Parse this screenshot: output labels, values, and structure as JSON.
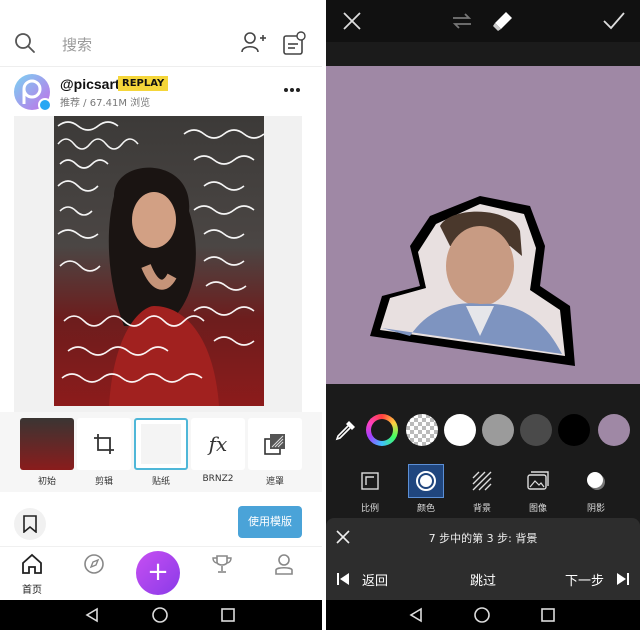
{
  "left": {
    "search": {
      "placeholder": "搜索"
    },
    "post": {
      "author": "@picsart",
      "badge": "REPLAY",
      "meta": "推荐 / 67.41M 浏览"
    },
    "tools": [
      {
        "label": "初始"
      },
      {
        "label": "剪辑"
      },
      {
        "label": "贴纸"
      },
      {
        "label": "BRNZ2"
      },
      {
        "label": "遮罩"
      }
    ],
    "use_template_label": "使用模版",
    "nav": [
      {
        "label": "首页",
        "icon": "home-icon"
      },
      {
        "label": "",
        "icon": "compass-icon"
      },
      {
        "label": "",
        "icon": "plus-icon"
      },
      {
        "label": "",
        "icon": "trophy-icon"
      },
      {
        "label": "",
        "icon": "profile-icon"
      }
    ]
  },
  "right": {
    "canvas_color": "#9f88a5",
    "swatches": [
      {
        "name": "color-wheel",
        "color": "conic"
      },
      {
        "name": "transparent",
        "color": "checker"
      },
      {
        "name": "white",
        "color": "#ffffff"
      },
      {
        "name": "light-gray",
        "color": "#9b9b9b"
      },
      {
        "name": "dark-gray",
        "color": "#4a4a4a"
      },
      {
        "name": "black",
        "color": "#000000"
      },
      {
        "name": "lilac",
        "color": "#9f88a5"
      }
    ],
    "modes": [
      {
        "label": "比例"
      },
      {
        "label": "颜色"
      },
      {
        "label": "背景"
      },
      {
        "label": "图像"
      },
      {
        "label": "阴影"
      }
    ],
    "tutorial": {
      "progress": "7 步中的第 3 步: 背景",
      "back": "返回",
      "skip": "跳过",
      "next": "下一步"
    }
  },
  "colors": {
    "accent_blue": "#4aa3d8",
    "fab_purple": "#a346ef",
    "badge_yellow": "#f5d63a"
  }
}
